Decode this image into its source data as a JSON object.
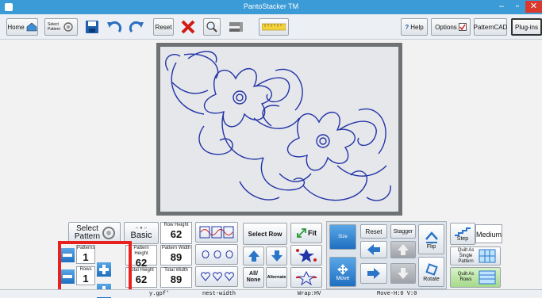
{
  "window": {
    "title": "PantoStacker TM",
    "minimize": "–",
    "restore": "▫",
    "close": "✕"
  },
  "toolbar": {
    "home_label": "Home",
    "select_pattern_label": "Select Pattern",
    "reset_label": "Reset",
    "help_label": "Help",
    "options_label": "Options",
    "patterncad_label": "PatternCAD",
    "plugins_label": "Plug-ins"
  },
  "panel": {
    "select_pattern": "Select Pattern",
    "basic": "Basic",
    "row_height_label": "Row Height",
    "row_height_value": "62",
    "pattern_height_label": "Pattern Height",
    "pattern_height_value": "62",
    "pattern_width_label": "Pattern Width",
    "pattern_width_value": "89",
    "total_height_label": "Total Height",
    "total_height_value": "62",
    "total_width_label": "Total Width",
    "total_width_value": "89",
    "patterns_label": "Patterns",
    "patterns_value": "1",
    "rows_label": "Rows",
    "rows_value": "1",
    "select_row": "Select Row",
    "fit": "Fit",
    "all_none": "All/ None",
    "alternate": "Alternate",
    "size": "Size",
    "reset": "Reset",
    "stagger": "Stagger",
    "flip": "Flip",
    "move": "Move",
    "rotate": "Rotate",
    "step": "Step",
    "medium": "Medium",
    "quilt_single": "Quilt As Single Pattern",
    "quilt_rows": "Quilt As Rows"
  },
  "statusbar": {
    "file": "y.gpf'",
    "mode": "nest-width",
    "wrap": "Wrap:HV",
    "move": "Move-H:0 V:0"
  },
  "colors": {
    "titlebar": "#3a9bd6",
    "highlight": "#e8201e",
    "pattern_stroke": "#2234a8"
  }
}
